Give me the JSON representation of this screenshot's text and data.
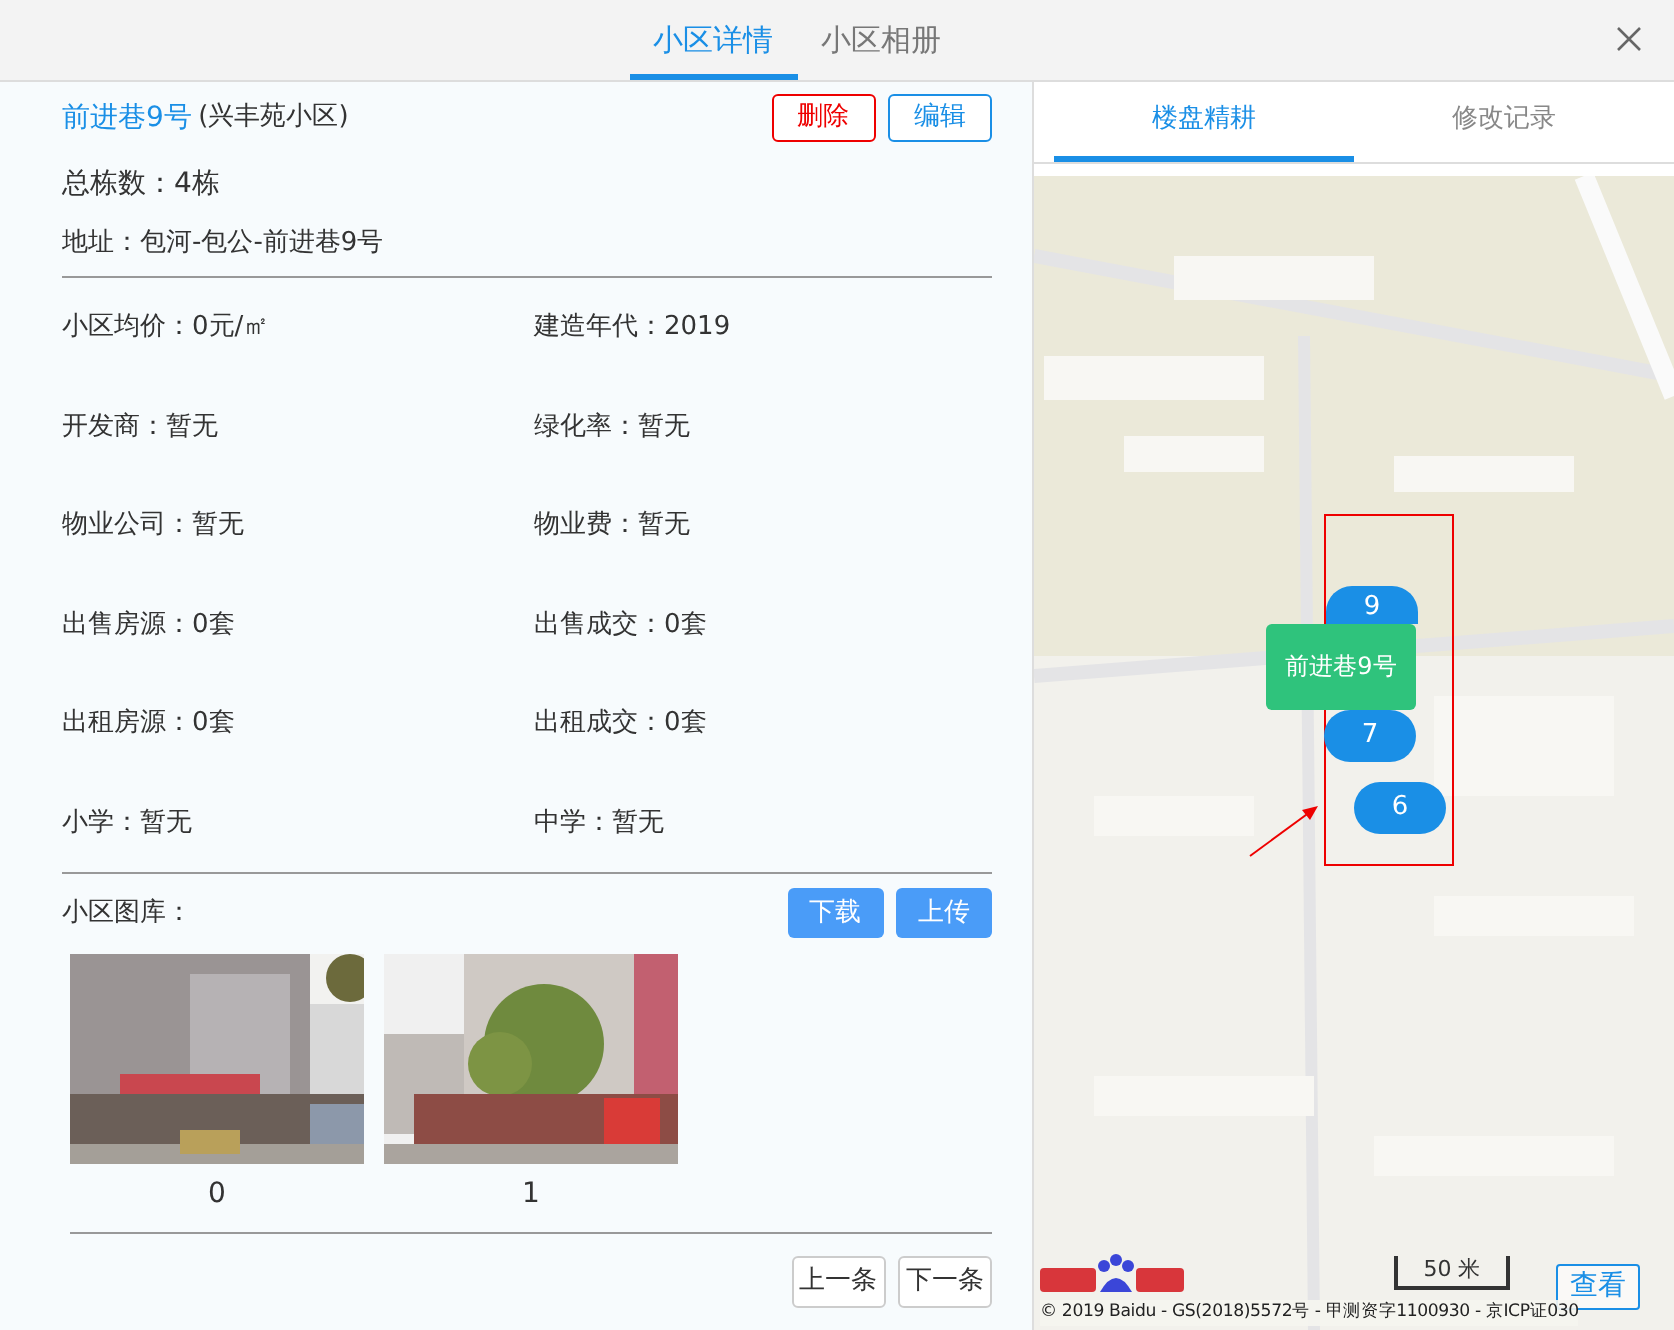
{
  "tabs": [
    {
      "label": "小区详情",
      "selected": true
    },
    {
      "label": "小区相册",
      "selected": false
    }
  ],
  "community": {
    "name": "前进巷9号",
    "parent": "(兴丰苑小区)",
    "buttons": [
      {
        "label": "删除",
        "kind": "danger"
      },
      {
        "label": "编辑",
        "kind": "primary"
      }
    ],
    "building_count": "总栋数：4栋",
    "address": "地址：包河-包公-前进巷9号"
  },
  "details": [
    "小区均价：0元/㎡",
    "建造年代：2019",
    "开发商：暂无",
    "绿化率：暂无",
    "物业公司：暂无",
    "物业费：暂无",
    "出售房源：0套",
    "出售成交：0套",
    "出租房源：0套",
    "出租成交：0套",
    "小学：暂无",
    "中学：暂无"
  ],
  "gallery": {
    "label": "小区图库：",
    "buttons": [
      "下载",
      "上传"
    ],
    "photos": [
      {
        "kind": "picture",
        "caption": "0"
      },
      {
        "kind": "picture",
        "caption": "1"
      }
    ]
  },
  "pager": [
    "上一条",
    "下一条"
  ],
  "map_tabs": [
    {
      "label": "楼盘精耕",
      "selected": true
    },
    {
      "label": "修改记录",
      "selected": false
    }
  ],
  "map": {
    "markers": [
      {
        "label": "9"
      },
      {
        "label": "7"
      },
      {
        "label": "6"
      }
    ],
    "building_label": "前进巷9号",
    "scale": "50 米",
    "copyright": "© 2019 Baidu - GS(2018)5572号 - 甲测资字1100930 - 京ICP证030",
    "view_button": "查看"
  }
}
